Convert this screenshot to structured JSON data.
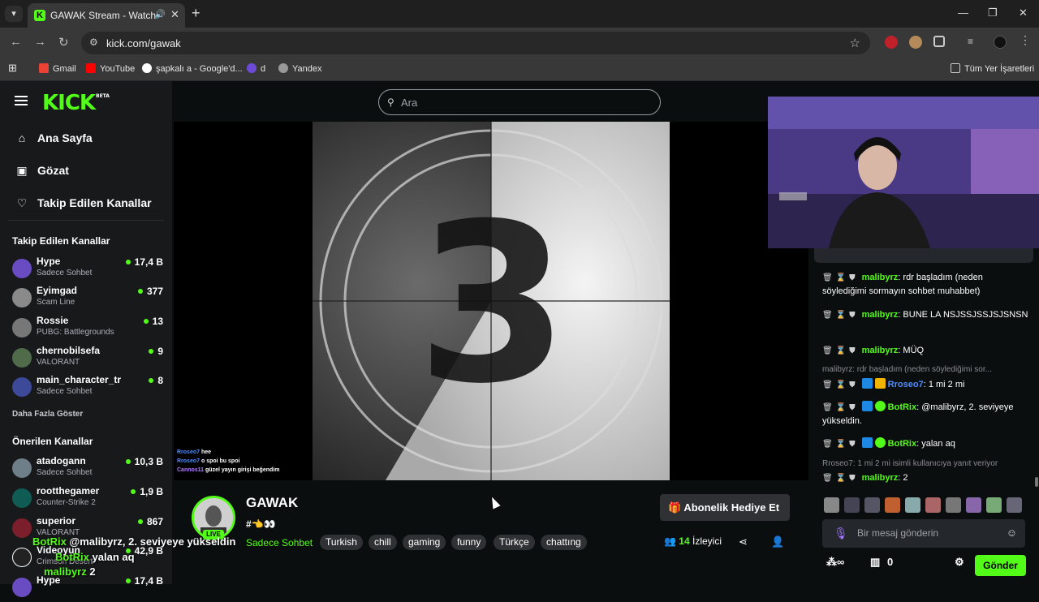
{
  "browser": {
    "tab_title": "GAWAK Stream - Watch Live",
    "url": "kick.com/gawak",
    "bookmarks": [
      "Gmail",
      "YouTube",
      "şapkalı a - Google'd...",
      "d",
      "Yandex"
    ],
    "all_bookmarks": "Tüm Yer İşaretleri"
  },
  "brand": {
    "logo": "KICK",
    "beta": "BETA",
    "accent": "#53fc18"
  },
  "nav": {
    "home": "Ana Sayfa",
    "browse": "Gözat",
    "following": "Takip Edilen Kanallar"
  },
  "search": {
    "placeholder": "Ara"
  },
  "followed": {
    "title": "Takip Edilen Kanallar",
    "channels": [
      {
        "name": "Hype",
        "category": "Sadece Sohbet",
        "viewers": "17,4 B"
      },
      {
        "name": "Eyimgad",
        "category": "Scam Line",
        "viewers": "377"
      },
      {
        "name": "Rossie",
        "category": "PUBG: Battlegrounds",
        "viewers": "13"
      },
      {
        "name": "chernobilsefa",
        "category": "VALORANT",
        "viewers": "9"
      },
      {
        "name": "main_character_tr",
        "category": "Sadece Sohbet",
        "viewers": "8"
      }
    ],
    "more": "Daha Fazla Göster"
  },
  "recommended": {
    "title": "Önerilen Kanallar",
    "channels": [
      {
        "name": "atadogann",
        "category": "Sadece Sohbet",
        "viewers": "10,3 B"
      },
      {
        "name": "rootthegamer",
        "category": "Counter-Strike 2",
        "viewers": "1,9 B"
      },
      {
        "name": "superior",
        "category": "VALORANT",
        "viewers": "867"
      },
      {
        "name": "Videoyun",
        "category": "Crimson Desert",
        "viewers": "42,9 B"
      },
      {
        "name": "Hype",
        "category": "",
        "viewers": "17,4 B"
      }
    ]
  },
  "video": {
    "countdown": "3",
    "overlay_chat": [
      {
        "user": "Rroseo7",
        "text": "hee"
      },
      {
        "user": "Rroseo7",
        "text": "o spoi bu spoi"
      },
      {
        "user": "Cannos11",
        "text": "güzel yayın girişi beğendim"
      }
    ]
  },
  "channel": {
    "name": "GAWAK",
    "live": "LIVE",
    "stream_title": "#👈👀",
    "category": "Sadece Sohbet",
    "tags": [
      "Turkish",
      "chill",
      "gaming",
      "funny",
      "Türkçe",
      "chattıng"
    ],
    "gift_sub": "Abonelik Hediye Et",
    "viewer_count": "14",
    "viewer_label": "İzleyici"
  },
  "stream_overlay_chat": [
    {
      "user": "BotRix",
      "text": "@malibyrz, 2. seviyeye yükseldin"
    },
    {
      "user": "BotRix",
      "text": "yalan aq"
    },
    {
      "user": "malibyrz",
      "text": "2"
    }
  ],
  "chat": {
    "messages": [
      {
        "reply": "",
        "user": "malibyrz",
        "text": "rdr başladım (neden söylediğimi sormayın sohbet muhabbet)",
        "color": "#53fc18"
      },
      {
        "reply": "",
        "user": "malibyrz",
        "text": "BUNE LA NSJSSJSSJSJSNSN",
        "color": "#53fc18"
      },
      {
        "reply": "",
        "user": "malibyrz",
        "text": "MÜQ",
        "color": "#53fc18"
      },
      {
        "reply": "malibyrz: rdr başladım (neden söylediğimi sor...",
        "user": "Rroseo7",
        "text": "1 mi 2 mi",
        "color": "#4e8cff"
      },
      {
        "reply": "",
        "user": "BotRix",
        "text": "@malibyrz, 2. seviyeye yükseldin.",
        "color": "#53fc18"
      },
      {
        "reply": "",
        "user": "BotRix",
        "text": "yalan aq",
        "color": "#53fc18"
      },
      {
        "reply": "Rroseo7: 1 mi 2 mi isimli kullanıcıya yanıt veriyor",
        "user": "malibyrz",
        "text": "2",
        "color": "#53fc18"
      }
    ],
    "input_placeholder": "Bir mesaj gönderin",
    "points": "0",
    "send": "Gönder"
  }
}
